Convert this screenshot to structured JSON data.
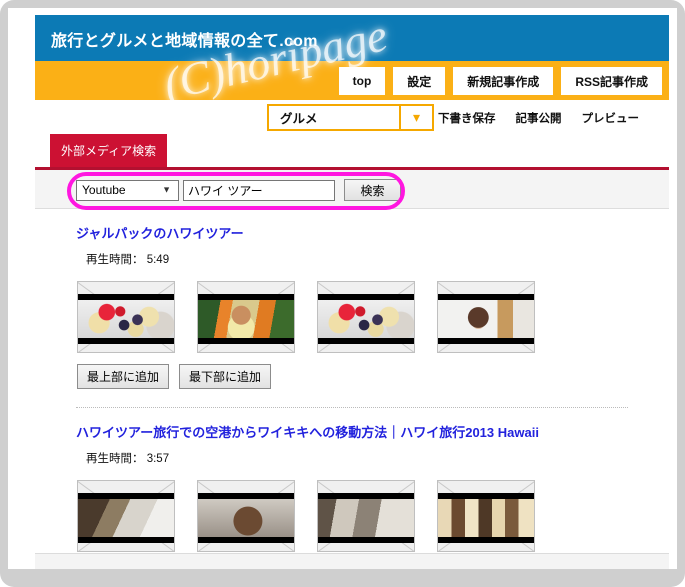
{
  "window": {
    "frame_color": "#cfcfcf"
  },
  "header": {
    "title": "旅行とグルメと地域情報の全て.com",
    "background": "#0c7ab5",
    "nav_background": "#fbb016",
    "watermark": "(C)horipage"
  },
  "nav": {
    "buttons": [
      {
        "label": "top"
      },
      {
        "label": "設定"
      },
      {
        "label": "新規記事作成"
      },
      {
        "label": "RSS記事作成"
      }
    ]
  },
  "subnav": {
    "category_value": "グルメ",
    "caret": "chevron-down-icon",
    "actions": [
      {
        "label": "下書き保存"
      },
      {
        "label": "記事公開"
      },
      {
        "label": "プレビュー"
      }
    ]
  },
  "tabs": [
    {
      "label": "外部メディア検索",
      "active": true,
      "color": "#cc1133"
    }
  ],
  "search": {
    "source_value": "Youtube",
    "query_value": "ハワイ ツアー",
    "query_placeholder": "",
    "button_label": "検索",
    "annotation_color": "#ff16e0"
  },
  "results": [
    {
      "title": "ジャルパックのハワイツアー",
      "duration_label": "再生時間：",
      "duration_value": "5:49",
      "thumbnails": [
        {
          "name": "thumbnail-fruit-bowl",
          "style": "pic-fruit"
        },
        {
          "name": "thumbnail-lei-girl",
          "style": "pic-lei"
        },
        {
          "name": "thumbnail-fruit-bowl-2",
          "style": "pic-fruit"
        },
        {
          "name": "thumbnail-woman-interview",
          "style": "pic-person"
        }
      ],
      "add_top_label": "最上部に追加",
      "add_bottom_label": "最下部に追加"
    },
    {
      "title": "ハワイツアー旅行での空港からワイキキへの移動方法｜ハワイ旅行2013 Hawaii",
      "duration_label": "再生時間：",
      "duration_value": "3:57",
      "thumbnails": [
        {
          "name": "thumbnail-airport-walkway",
          "style": "pic-interior"
        },
        {
          "name": "thumbnail-face-closeup",
          "style": "pic-face"
        },
        {
          "name": "thumbnail-terminal-room",
          "style": "pic-room"
        },
        {
          "name": "thumbnail-photo-grid",
          "style": "pic-grid"
        }
      ]
    }
  ]
}
